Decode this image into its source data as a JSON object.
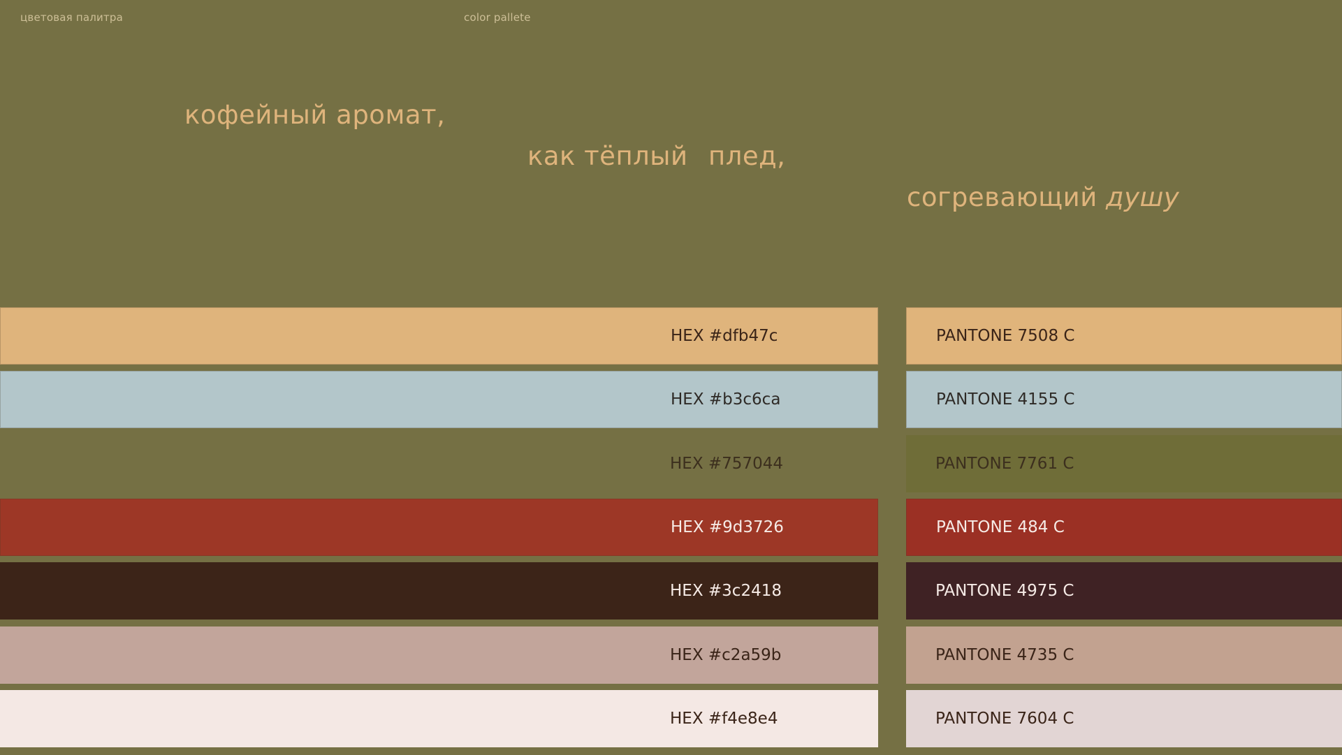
{
  "header": {
    "label_ru": "цветовая палитра",
    "label_en": "color pallete"
  },
  "tagline": {
    "line1": "кофейный  аромат,",
    "line2a": "как тёплый",
    "line2b": "плед,",
    "line3_regular": "согревающий ",
    "line3_italic": "душу"
  },
  "palette": [
    {
      "hex_label": "HEX #dfb47c",
      "pantone_label": "PANTONE 7508 C",
      "hex_color": "#dfb47c",
      "pantone_color": "#e0b47b",
      "text_color": "#3a2418"
    },
    {
      "hex_label": "HEX #b3c6ca",
      "pantone_label": "PANTONE 4155 C",
      "hex_color": "#b3c6ca",
      "pantone_color": "#b3c6ca",
      "text_color": "#2e2a26"
    },
    {
      "hex_label": "HEX #757044",
      "pantone_label": "PANTONE 7761 C",
      "hex_color": "#757044",
      "pantone_color": "#6f6d38",
      "text_color": "#3c2f1e"
    },
    {
      "hex_label": "HEX #9d3726",
      "pantone_label": "PANTONE 484 C",
      "hex_color": "#9d3726",
      "pantone_color": "#9b3024",
      "text_color": "#f6ebe6"
    },
    {
      "hex_label": "HEX #3c2418",
      "pantone_label": "PANTONE 4975 C",
      "hex_color": "#3c2418",
      "pantone_color": "#3f2224",
      "text_color": "#f6ebe6"
    },
    {
      "hex_label": "HEX #c2a59b",
      "pantone_label": "PANTONE 4735 C",
      "hex_color": "#c2a59b",
      "pantone_color": "#c2a290",
      "text_color": "#3a2418"
    },
    {
      "hex_label": "HEX #f4e8e4",
      "pantone_label": "PANTONE 7604 C",
      "hex_color": "#f4e8e4",
      "pantone_color": "#e2d5d4",
      "text_color": "#3a2418"
    }
  ]
}
